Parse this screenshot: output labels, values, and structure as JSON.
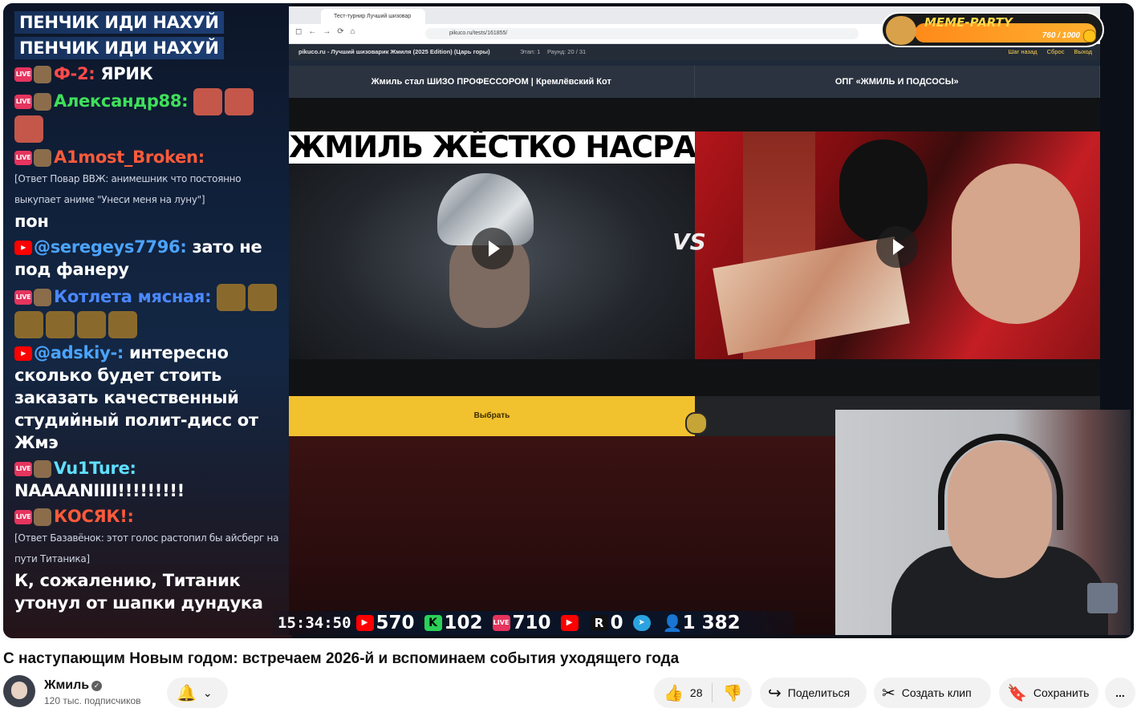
{
  "chat": {
    "lines": [
      {
        "text": "ПЕНЧИК ИДИ НАХУЙ"
      },
      {
        "text": "ПЕНЧИК ИДИ НАХУЙ"
      }
    ],
    "messages": [
      {
        "user": "Ф-2:",
        "text": "ЯРИК"
      },
      {
        "user": "Александр88:",
        "text": ""
      },
      {
        "user": "A1most_Broken:",
        "reply": "[Ответ Повар ВВЖ: анимешник что постоянно выкупает аниме \"Унеси меня на луну\"]",
        "text": "пон"
      },
      {
        "user": "@seregeys7796:",
        "text": "зато не под фанеру"
      },
      {
        "user": "Котлета мясная:",
        "text": ""
      },
      {
        "user": "@adskiy-:",
        "text": "интересно сколько будет стоить заказать качественный студийный полит-дисс от Жмэ"
      },
      {
        "user": "Vu1Ture:",
        "text": "NAAAANIIII!!!!!!!!!"
      },
      {
        "user": "КОСЯК!:",
        "reply": "[Ответ Базавёнок: этот голос растопил бы айсберг на пути Титаника]",
        "text": "К, сожалению, Титаник утонул от шапки дундука"
      }
    ],
    "badge_live": "LIVE"
  },
  "browser": {
    "tab_title": "Тест-турнир Лучший шизовар",
    "url": "pikuco.ru/tests/161855/",
    "site_title": "pikuco.ru - Лучший шизоварик Жмиля (2025 Edition) (Царь горы)",
    "stage": "Этап: 1",
    "round": "Раунд: 20 / 31",
    "actions": [
      "Шаг назад",
      "Сброс",
      "Выход"
    ]
  },
  "options": [
    "Жмиль стал ШИЗО ПРОФЕССОРОМ | Кремлёвский Кот",
    "ОПГ «ЖМИЛЬ И ПОДСОСЫ»"
  ],
  "thumbnail_left_title": "ЖМИЛЬ ЖЁСТКО НАСРАЛ",
  "vs_label": "VS",
  "select_label": "Выбрать",
  "meme_party": {
    "title": "MEME-PARTY",
    "count": "760 / 1000"
  },
  "stats": {
    "time": "15:34:50",
    "youtube": "570",
    "kick": "102",
    "live": "710",
    "rutube": "0",
    "viewers": "1 382"
  },
  "video": {
    "title": "С наступающим Новым годом: встречаем 2026-й и вспоминаем события уходящего года",
    "channel": "Жмиль",
    "subscribers": "120 тыс. подписчиков",
    "likes": "28",
    "share": "Поделиться",
    "clip": "Создать клип",
    "save": "Сохранить",
    "more": "..."
  }
}
